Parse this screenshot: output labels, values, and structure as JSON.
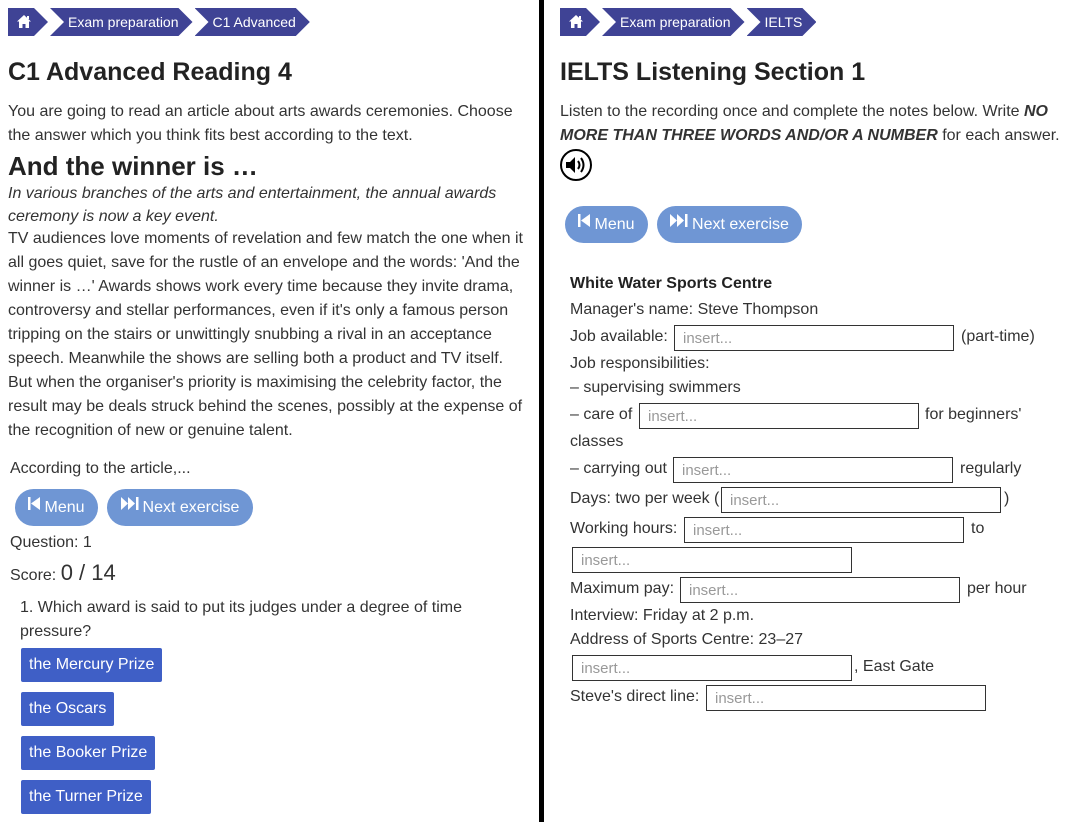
{
  "left": {
    "breadcrumb": [
      "Exam preparation",
      "C1 Advanced"
    ],
    "title": "C1 Advanced Reading 4",
    "intro": "You are going to read an article about arts awards ceremonies. Choose the answer which you think fits best according to the text.",
    "article_title": "And the winner is …",
    "standfirst": "In various branches of the arts and entertainment, the annual awards ceremony is now a key event.",
    "article_body": "TV audiences love moments of revelation and few match the one when it all goes quiet, save for the rustle of an envelope and the words: 'And the winner is …' Awards shows work every time because they invite drama, controversy and stellar performances, even if it's only a famous person tripping on the stairs or unwittingly snubbing a rival in an acceptance speech. Meanwhile the shows are selling both a product and TV itself. But when the organiser's priority is maximising the celebrity factor, the result may be deals struck behind the scenes, possibly at the expense of the recognition of new or genuine talent.",
    "according": "According to the article,...",
    "menu_label": "Menu",
    "next_label": "Next exercise",
    "question_label": "Question: 1",
    "score_label": "Score:",
    "score_value": "0 / 14",
    "question_text": "1. Which award is said to put its judges under a degree of time pressure?",
    "answers": [
      "the Mercury Prize",
      "the Oscars",
      "the Booker Prize",
      "the Turner Prize"
    ]
  },
  "right": {
    "breadcrumb": [
      "Exam preparation",
      "IELTS"
    ],
    "title": "IELTS Listening Section 1",
    "intro_prefix": "Listen to the recording once and complete the notes below. Write ",
    "intro_emphasis": "NO MORE THAN THREE WORDS AND/OR A NUMBER",
    "intro_suffix": " for each answer.",
    "menu_label": "Menu",
    "next_label": "Next exercise",
    "notes": {
      "title": "White Water Sports Centre",
      "manager": "Manager's name: Steve Thompson",
      "job_available": "Job available:",
      "part_time": "(part-time)",
      "responsibilities": "Job responsibilities:",
      "supervising": "– supervising swimmers",
      "care_of": "– care of",
      "for_beginners": "for beginners'",
      "classes": "classes",
      "carrying_out": "– carrying out",
      "regularly": "regularly",
      "days": "Days: two per week (",
      "days_close": ")",
      "working_hours": "Working hours:",
      "to": "to",
      "max_pay": "Maximum pay:",
      "per_hour": "per hour",
      "interview": "Interview: Friday at 2 p.m.",
      "address": "Address of Sports Centre: 23–27",
      "east_gate": ", East Gate",
      "direct_line": "Steve's direct line:"
    },
    "placeholder": "insert..."
  }
}
